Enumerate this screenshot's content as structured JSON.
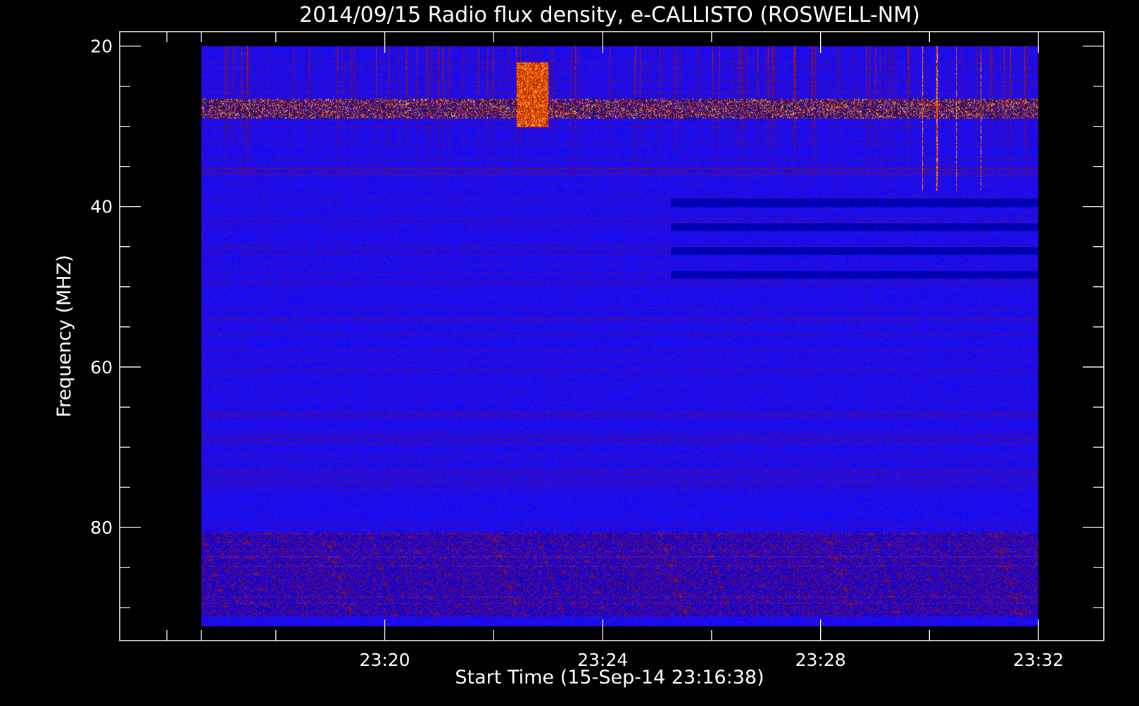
{
  "chart_data": {
    "type": "heatmap",
    "title": "2014/09/15  Radio flux density, e-CALLISTO (ROSWELL-NM)",
    "xlabel": "Start Time (15-Sep-14 23:16:38)",
    "ylabel": "Frequency (MHZ)",
    "x_start": "23:16:38",
    "x_end": "23:32:00",
    "xlim": [
      "23:15:08",
      "23:33:12"
    ],
    "ylim": [
      18.2,
      94.1
    ],
    "y_inverted": true,
    "data_extent_y": [
      20,
      92.3
    ],
    "x_ticks": [
      "23:20",
      "23:24",
      "23:28",
      "23:32"
    ],
    "y_ticks": [
      20,
      40,
      60,
      80
    ],
    "colormap": [
      "#000000",
      "#000070",
      "#0000e6",
      "#1a10ff",
      "#8a0810",
      "#d42000",
      "#ff7a00",
      "#ffff50",
      "#ffffff"
    ],
    "background_level_color": "#1a10ff",
    "features": [
      {
        "kind": "band",
        "freq": [
          26.5,
          29
        ],
        "intensity": "strong",
        "label_note": "persistent bright interference band"
      },
      {
        "kind": "band",
        "freq": [
          80.5,
          91
        ],
        "intensity": "weak"
      },
      {
        "kind": "burst",
        "time": [
          "23:22:25",
          "23:23:00"
        ],
        "freq": [
          22,
          30
        ],
        "intensity": "strong"
      },
      {
        "kind": "dark-blocks",
        "time": [
          "23:25:15",
          "23:32:00"
        ],
        "freq": [
          39,
          51
        ]
      },
      {
        "kind": "striations",
        "time": [
          "23:29:45",
          "23:31:00"
        ],
        "freq": [
          20,
          38
        ],
        "intensity": "strong"
      }
    ]
  }
}
